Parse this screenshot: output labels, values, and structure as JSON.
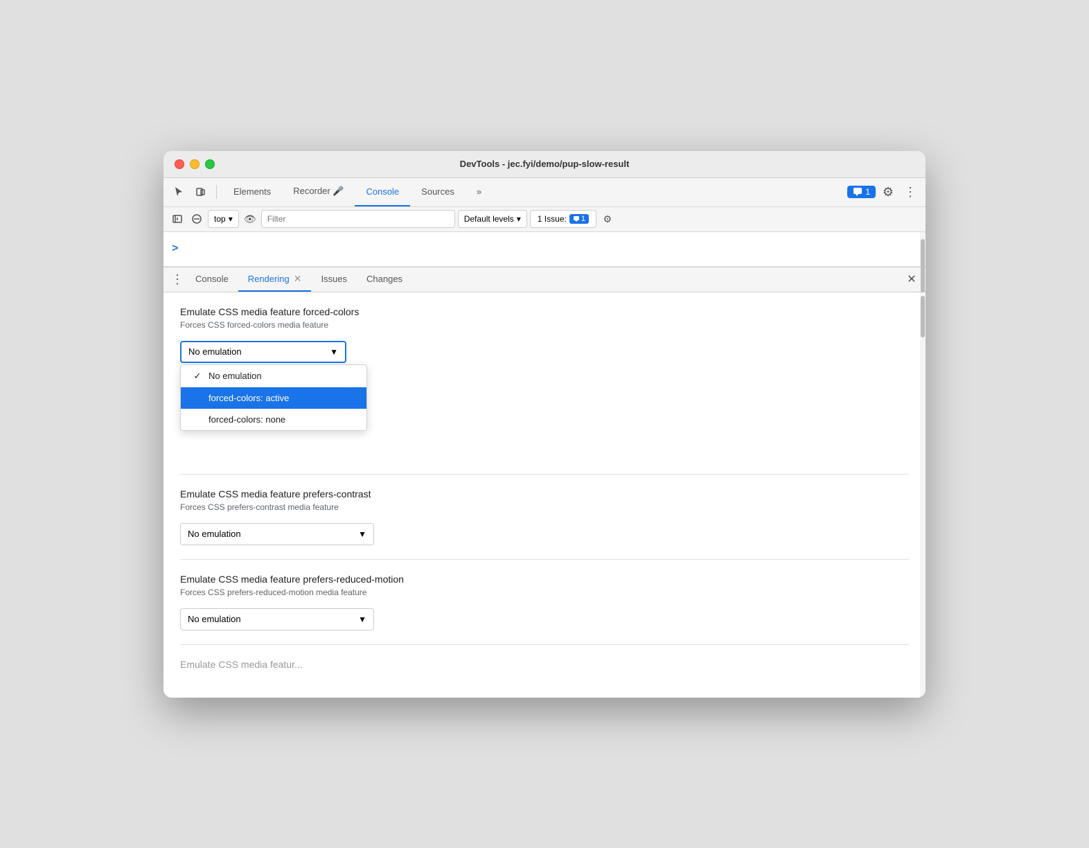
{
  "window": {
    "title": "DevTools - jec.fyi/demo/pup-slow-result"
  },
  "titlebar": {
    "title": "DevTools - jec.fyi/demo/pup-slow-result"
  },
  "toolbar": {
    "tabs": [
      {
        "id": "elements",
        "label": "Elements",
        "active": false
      },
      {
        "id": "recorder",
        "label": "Recorder 🎤",
        "active": false
      },
      {
        "id": "console",
        "label": "Console",
        "active": true
      },
      {
        "id": "sources",
        "label": "Sources",
        "active": false
      }
    ],
    "more_label": "»",
    "badge_count": "1",
    "gear_icon": "⚙",
    "dots_icon": "⋮"
  },
  "console_toolbar": {
    "play_icon": "▶",
    "block_icon": "🚫",
    "context_label": "top",
    "chevron": "▾",
    "eye_icon": "👁",
    "filter_placeholder": "Filter",
    "levels_label": "Default levels",
    "levels_chevron": "▾",
    "issues_label": "1 Issue:",
    "issues_count": "1",
    "gear_icon": "⚙"
  },
  "drawer_tabs": [
    {
      "id": "console",
      "label": "Console",
      "active": false,
      "closable": false
    },
    {
      "id": "rendering",
      "label": "Rendering",
      "active": true,
      "closable": true
    },
    {
      "id": "issues",
      "label": "Issues",
      "active": false,
      "closable": false
    },
    {
      "id": "changes",
      "label": "Changes",
      "active": false,
      "closable": false
    }
  ],
  "rendering": {
    "forced_colors": {
      "title": "Emulate CSS media feature forced-colors",
      "subtitle": "Forces CSS forced-colors media feature",
      "selected_value": "No emulation",
      "options": [
        {
          "id": "no-emulation",
          "label": "No emulation",
          "selected": true
        },
        {
          "id": "forced-active",
          "label": "forced-colors: active",
          "highlighted": true
        },
        {
          "id": "forced-none",
          "label": "forced-colors: none",
          "highlighted": false
        }
      ]
    },
    "prefers_contrast": {
      "title": "Emulate CSS media feature prefers-contrast",
      "subtitle": "Forces CSS prefers-contrast media feature",
      "selected_value": "No emulation"
    },
    "prefers_reduced_motion": {
      "title": "Emulate CSS media feature prefers-reduced-motion",
      "subtitle": "Forces CSS prefers-reduced-motion media feature",
      "selected_value": "No emulation"
    },
    "section_bottom_partial": "Emulate CSS media featur..."
  }
}
